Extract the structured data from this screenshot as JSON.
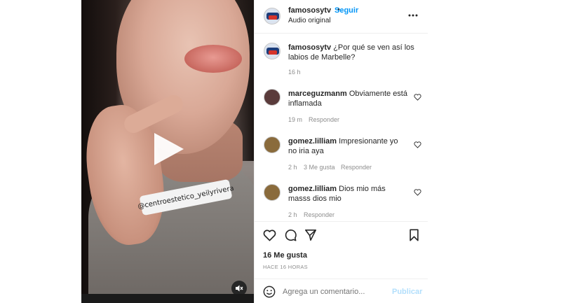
{
  "post": {
    "username": "famososytv",
    "follow_separator": "•",
    "follow_label": "Seguir",
    "audio_label": "Audio original",
    "more_icon": "more-horizontal-icon",
    "caption": "¿Por qué se ven así los labios de Marbelle?",
    "caption_time": "16 h"
  },
  "video": {
    "overlay_tag": "@centroestetico_yeilyrivera",
    "play_icon": "play-icon",
    "mute_icon": "speaker-muted-icon"
  },
  "comments": [
    {
      "username": "marceguzmanm",
      "text": "Obviamente está inflamada",
      "time": "19 m",
      "likes": "",
      "reply": "Responder"
    },
    {
      "username": "gomez.lilliam",
      "text": "Impresionante yo no iria aya",
      "time": "2 h",
      "likes": "3 Me gusta",
      "reply": "Responder"
    },
    {
      "username": "gomez.lilliam",
      "text": "Dios mio más masss dios mio",
      "time": "2 h",
      "likes": "",
      "reply": "Responder"
    }
  ],
  "actions": {
    "like_icon": "heart-icon",
    "comment_icon": "comment-icon",
    "share_icon": "send-icon",
    "save_icon": "bookmark-icon",
    "likes_count": "16 Me gusta",
    "posted_ago": "HACE 16 HORAS"
  },
  "add_comment": {
    "emoji_icon": "emoji-icon",
    "placeholder": "Agrega un comentario...",
    "publish_label": "Publicar"
  },
  "colors": {
    "accent": "#0095f6",
    "publish_disabled": "#b2dffc",
    "muted_text": "#8e8e8e"
  }
}
